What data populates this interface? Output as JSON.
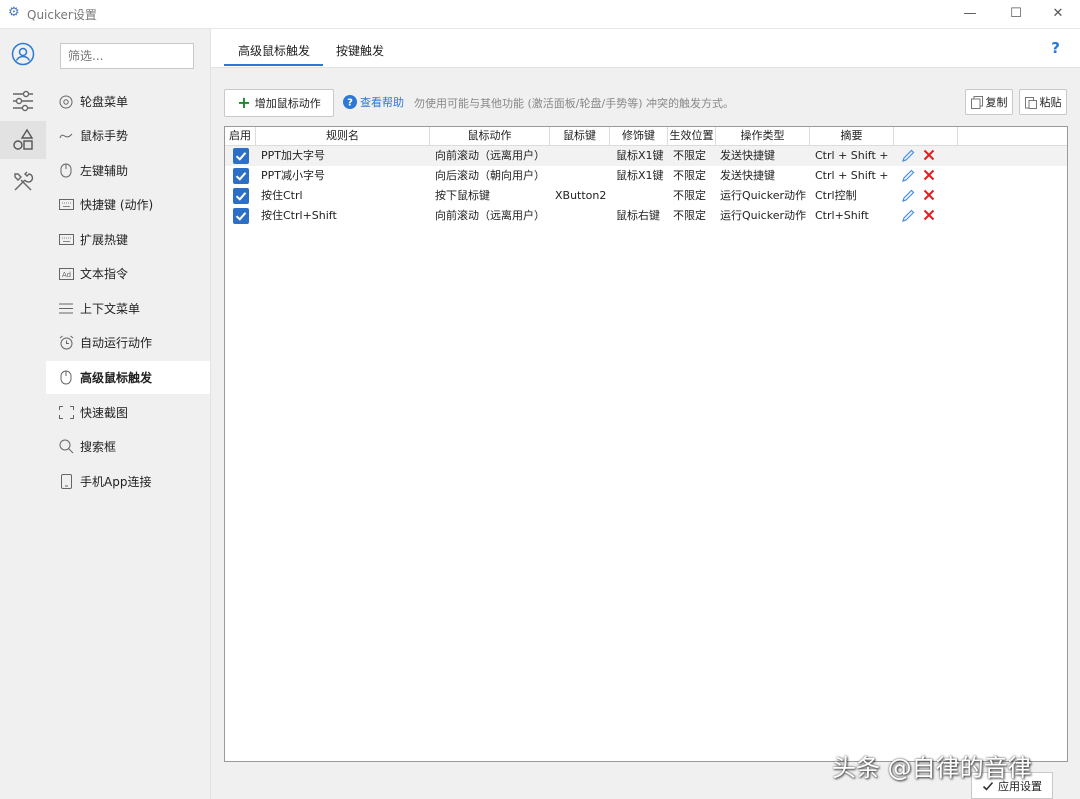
{
  "window": {
    "title": "Quicker设置",
    "minimize": "—",
    "maximize": "☐",
    "close": "✕"
  },
  "sidebar": {
    "filter_placeholder": "筛选...",
    "items": [
      {
        "label": "轮盘菜单",
        "icon": "wheel-icon"
      },
      {
        "label": "鼠标手势",
        "icon": "gesture-icon"
      },
      {
        "label": "左键辅助",
        "icon": "mouse-icon"
      },
      {
        "label": "快捷键 (动作)",
        "icon": "keyboard-icon"
      },
      {
        "label": "扩展热键",
        "icon": "keyboard-icon"
      },
      {
        "label": "文本指令",
        "icon": "ad-icon"
      },
      {
        "label": "上下文菜单",
        "icon": "menu-lines-icon"
      },
      {
        "label": "自动运行动作",
        "icon": "alarm-icon"
      },
      {
        "label": "高级鼠标触发",
        "icon": "mouse-icon",
        "active": true
      },
      {
        "label": "快速截图",
        "icon": "screenshot-icon"
      },
      {
        "label": "搜索框",
        "icon": "search-icon"
      },
      {
        "label": "手机App连接",
        "icon": "phone-icon"
      }
    ]
  },
  "tabs": [
    {
      "label": "高级鼠标触发",
      "active": true
    },
    {
      "label": "按键触发"
    }
  ],
  "help_q": "?",
  "toolbar": {
    "add_label": "增加鼠标动作",
    "help_label": "查看帮助",
    "hint": "勿使用可能与其他功能 (激活面板/轮盘/手势等) 冲突的触发方式。",
    "copy_label": "复制",
    "paste_label": "粘贴"
  },
  "table": {
    "columns": [
      "启用",
      "规则名",
      "鼠标动作",
      "鼠标键",
      "修饰键",
      "生效位置",
      "操作类型",
      "摘要"
    ],
    "rows": [
      {
        "name": "PPT加大字号",
        "action": "向前滚动（远离用户）",
        "key": "",
        "modifier": "鼠标X1键",
        "scope": "不限定",
        "op": "发送快捷键",
        "summary": "Ctrl + Shift + ."
      },
      {
        "name": "PPT减小字号",
        "action": "向后滚动（朝向用户）",
        "key": "",
        "modifier": "鼠标X1键",
        "scope": "不限定",
        "op": "发送快捷键",
        "summary": "Ctrl + Shift + ,"
      },
      {
        "name": "按住Ctrl",
        "action": "按下鼠标键",
        "key": "XButton2",
        "modifier": "",
        "scope": "不限定",
        "op": "运行Quicker动作",
        "summary": "Ctrl控制"
      },
      {
        "name": "按住Ctrl+Shift",
        "action": "向前滚动（远离用户）",
        "key": "",
        "modifier": "鼠标右键",
        "scope": "不限定",
        "op": "运行Quicker动作",
        "summary": "Ctrl+Shift"
      }
    ]
  },
  "apply_label": "应用设置",
  "watermark": "头条 @自律的音律"
}
